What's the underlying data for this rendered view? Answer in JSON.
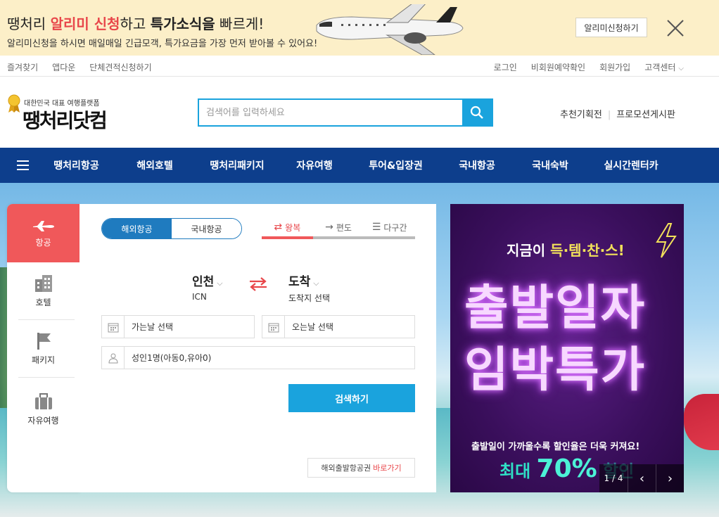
{
  "promo": {
    "title_pre": "땡처리 ",
    "title_hl": "알리미 신청",
    "title_mid": "하고 ",
    "title_b": "특가소식을",
    "title_post": " 빠르게!",
    "subtitle": "알리미신청을 하시면 매일매일 긴급모객, 특가요금을 가장 먼저 받아볼 수 있어요!",
    "apply_label": "알리미신청하기"
  },
  "util": {
    "left": [
      "즐겨찾기",
      "앱다운",
      "단체견적신청하기"
    ],
    "right": [
      "로그인",
      "비회원예약확인",
      "회원가입",
      "고객센터"
    ]
  },
  "header": {
    "logo_tag": "대한민국 대표 여행플랫폼",
    "logo_main": "땡처리",
    "logo_dot": "닷컴",
    "search_placeholder": "검색어를 입력하세요",
    "links": [
      "추천기획전",
      "프로모션게시판"
    ]
  },
  "nav": {
    "items": [
      "땡처리항공",
      "해외호텔",
      "땡처리패키지",
      "자유여행",
      "투어&입장권",
      "국내항공",
      "국내숙박",
      "실시간렌터카"
    ]
  },
  "booking": {
    "tabs": [
      "항공",
      "호텔",
      "패키지",
      "자유여행"
    ],
    "segment": [
      "해외항공",
      "국내항공"
    ],
    "trip": [
      "왕복",
      "편도",
      "다구간"
    ],
    "from_city": "인천",
    "from_code": "ICN",
    "to_city": "도착",
    "to_code": "도착지 선택",
    "depart_placeholder": "가는날 선택",
    "return_placeholder": "오는날 선택",
    "passengers": "성인1명(아동0,유아0)",
    "search_label": "검색하기",
    "shortcut_label": "해외출발항공권",
    "shortcut_link": "바로가기"
  },
  "ad": {
    "top_pre": "지금이 ",
    "top_hl": "득·템·찬·스!",
    "big1": "출발일자",
    "big2": "임박특가",
    "sub": "출발일이 가까울수록 할인율은 더욱 커져요!",
    "max_pre": "최대 ",
    "max_pct": "70%",
    "max_post": " 할인",
    "pager": "1 / 4"
  },
  "colors": {
    "brand_red": "#f0585a",
    "brand_blue": "#0d3e8c",
    "accent_cyan": "#1aa3dd",
    "promo_bg": "#fcefc8"
  }
}
